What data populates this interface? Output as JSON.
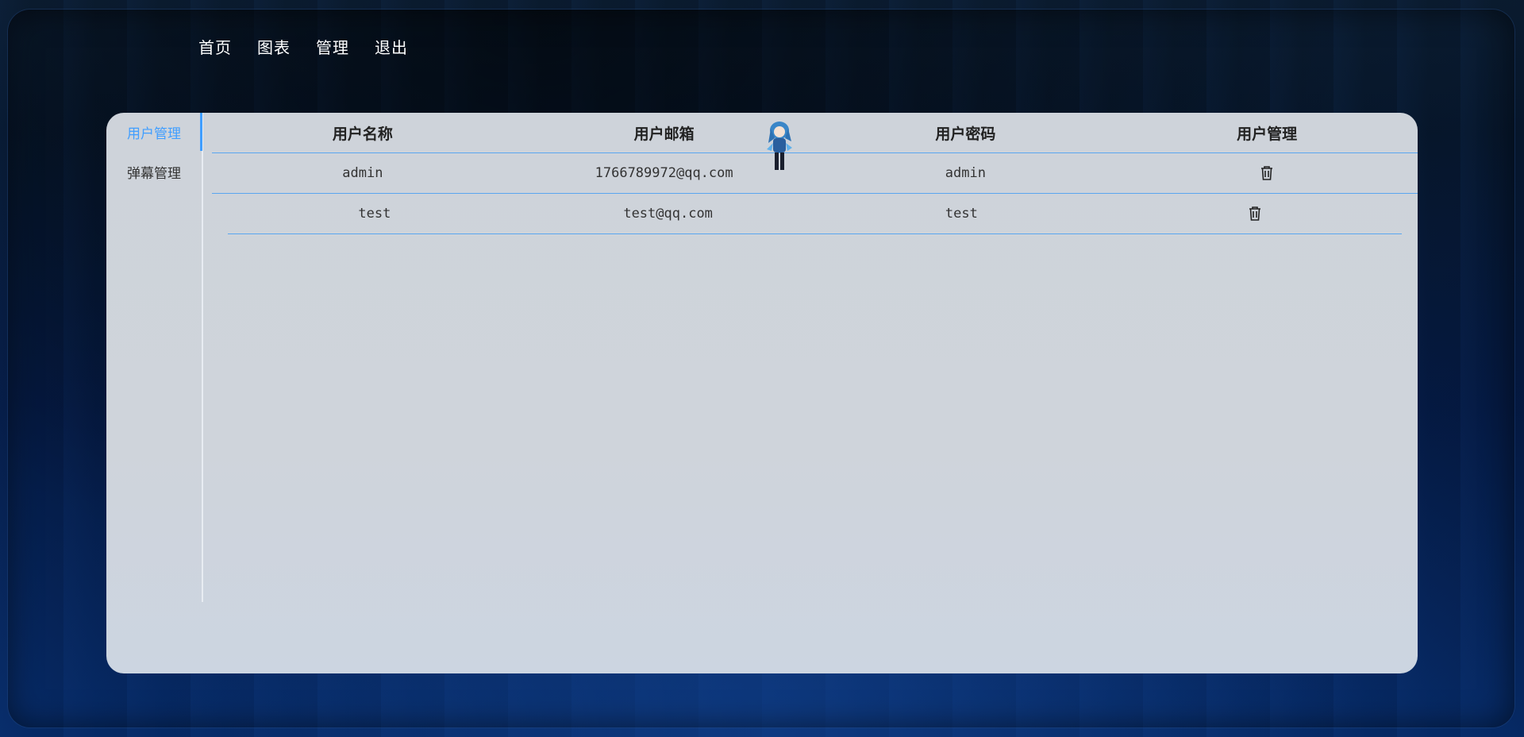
{
  "nav": {
    "items": [
      "首页",
      "图表",
      "管理",
      "退出"
    ]
  },
  "sidebar": {
    "items": [
      {
        "label": "用户管理",
        "active": true
      },
      {
        "label": "弹幕管理",
        "active": false
      }
    ]
  },
  "table": {
    "headers": [
      "用户名称",
      "用户邮箱",
      "用户密码",
      "用户管理"
    ],
    "rows": [
      {
        "name": "admin",
        "email": "1766789972@qq.com",
        "password": "admin",
        "action_icon": "trash-icon"
      },
      {
        "name": "test",
        "email": "test@qq.com",
        "password": "test",
        "action_icon": "trash-icon"
      }
    ]
  },
  "colors": {
    "accent": "#409eff",
    "panel": "#ced3da"
  }
}
